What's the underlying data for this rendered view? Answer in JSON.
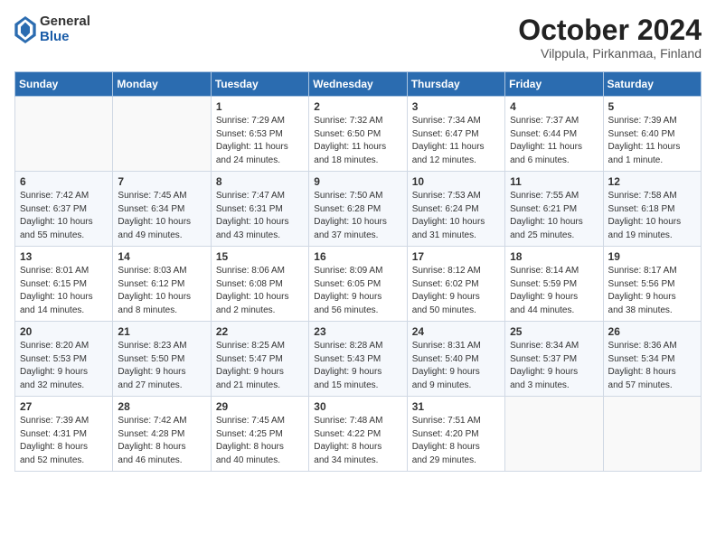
{
  "logo": {
    "general": "General",
    "blue": "Blue"
  },
  "header": {
    "month": "October 2024",
    "location": "Vilppula, Pirkanmaa, Finland"
  },
  "weekdays": [
    "Sunday",
    "Monday",
    "Tuesday",
    "Wednesday",
    "Thursday",
    "Friday",
    "Saturday"
  ],
  "weeks": [
    [
      {
        "day": "",
        "info": ""
      },
      {
        "day": "",
        "info": ""
      },
      {
        "day": "1",
        "info": "Sunrise: 7:29 AM\nSunset: 6:53 PM\nDaylight: 11 hours\nand 24 minutes."
      },
      {
        "day": "2",
        "info": "Sunrise: 7:32 AM\nSunset: 6:50 PM\nDaylight: 11 hours\nand 18 minutes."
      },
      {
        "day": "3",
        "info": "Sunrise: 7:34 AM\nSunset: 6:47 PM\nDaylight: 11 hours\nand 12 minutes."
      },
      {
        "day": "4",
        "info": "Sunrise: 7:37 AM\nSunset: 6:44 PM\nDaylight: 11 hours\nand 6 minutes."
      },
      {
        "day": "5",
        "info": "Sunrise: 7:39 AM\nSunset: 6:40 PM\nDaylight: 11 hours\nand 1 minute."
      }
    ],
    [
      {
        "day": "6",
        "info": "Sunrise: 7:42 AM\nSunset: 6:37 PM\nDaylight: 10 hours\nand 55 minutes."
      },
      {
        "day": "7",
        "info": "Sunrise: 7:45 AM\nSunset: 6:34 PM\nDaylight: 10 hours\nand 49 minutes."
      },
      {
        "day": "8",
        "info": "Sunrise: 7:47 AM\nSunset: 6:31 PM\nDaylight: 10 hours\nand 43 minutes."
      },
      {
        "day": "9",
        "info": "Sunrise: 7:50 AM\nSunset: 6:28 PM\nDaylight: 10 hours\nand 37 minutes."
      },
      {
        "day": "10",
        "info": "Sunrise: 7:53 AM\nSunset: 6:24 PM\nDaylight: 10 hours\nand 31 minutes."
      },
      {
        "day": "11",
        "info": "Sunrise: 7:55 AM\nSunset: 6:21 PM\nDaylight: 10 hours\nand 25 minutes."
      },
      {
        "day": "12",
        "info": "Sunrise: 7:58 AM\nSunset: 6:18 PM\nDaylight: 10 hours\nand 19 minutes."
      }
    ],
    [
      {
        "day": "13",
        "info": "Sunrise: 8:01 AM\nSunset: 6:15 PM\nDaylight: 10 hours\nand 14 minutes."
      },
      {
        "day": "14",
        "info": "Sunrise: 8:03 AM\nSunset: 6:12 PM\nDaylight: 10 hours\nand 8 minutes."
      },
      {
        "day": "15",
        "info": "Sunrise: 8:06 AM\nSunset: 6:08 PM\nDaylight: 10 hours\nand 2 minutes."
      },
      {
        "day": "16",
        "info": "Sunrise: 8:09 AM\nSunset: 6:05 PM\nDaylight: 9 hours\nand 56 minutes."
      },
      {
        "day": "17",
        "info": "Sunrise: 8:12 AM\nSunset: 6:02 PM\nDaylight: 9 hours\nand 50 minutes."
      },
      {
        "day": "18",
        "info": "Sunrise: 8:14 AM\nSunset: 5:59 PM\nDaylight: 9 hours\nand 44 minutes."
      },
      {
        "day": "19",
        "info": "Sunrise: 8:17 AM\nSunset: 5:56 PM\nDaylight: 9 hours\nand 38 minutes."
      }
    ],
    [
      {
        "day": "20",
        "info": "Sunrise: 8:20 AM\nSunset: 5:53 PM\nDaylight: 9 hours\nand 32 minutes."
      },
      {
        "day": "21",
        "info": "Sunrise: 8:23 AM\nSunset: 5:50 PM\nDaylight: 9 hours\nand 27 minutes."
      },
      {
        "day": "22",
        "info": "Sunrise: 8:25 AM\nSunset: 5:47 PM\nDaylight: 9 hours\nand 21 minutes."
      },
      {
        "day": "23",
        "info": "Sunrise: 8:28 AM\nSunset: 5:43 PM\nDaylight: 9 hours\nand 15 minutes."
      },
      {
        "day": "24",
        "info": "Sunrise: 8:31 AM\nSunset: 5:40 PM\nDaylight: 9 hours\nand 9 minutes."
      },
      {
        "day": "25",
        "info": "Sunrise: 8:34 AM\nSunset: 5:37 PM\nDaylight: 9 hours\nand 3 minutes."
      },
      {
        "day": "26",
        "info": "Sunrise: 8:36 AM\nSunset: 5:34 PM\nDaylight: 8 hours\nand 57 minutes."
      }
    ],
    [
      {
        "day": "27",
        "info": "Sunrise: 7:39 AM\nSunset: 4:31 PM\nDaylight: 8 hours\nand 52 minutes."
      },
      {
        "day": "28",
        "info": "Sunrise: 7:42 AM\nSunset: 4:28 PM\nDaylight: 8 hours\nand 46 minutes."
      },
      {
        "day": "29",
        "info": "Sunrise: 7:45 AM\nSunset: 4:25 PM\nDaylight: 8 hours\nand 40 minutes."
      },
      {
        "day": "30",
        "info": "Sunrise: 7:48 AM\nSunset: 4:22 PM\nDaylight: 8 hours\nand 34 minutes."
      },
      {
        "day": "31",
        "info": "Sunrise: 7:51 AM\nSunset: 4:20 PM\nDaylight: 8 hours\nand 29 minutes."
      },
      {
        "day": "",
        "info": ""
      },
      {
        "day": "",
        "info": ""
      }
    ]
  ]
}
